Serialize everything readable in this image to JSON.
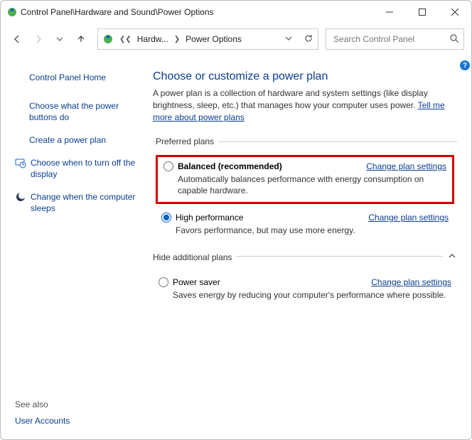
{
  "window": {
    "title": "Control Panel\\Hardware and Sound\\Power Options"
  },
  "nav": {
    "crumb1": "Hardw...",
    "crumb2": "Power Options"
  },
  "search": {
    "placeholder": "Search Control Panel"
  },
  "sidebar": {
    "home": "Control Panel Home",
    "whatbuttons": "Choose what the power buttons do",
    "createplan": "Create a power plan",
    "whenoff": "Choose when to turn off the display",
    "whensleep": "Change when the computer sleeps",
    "seealso_label": "See also",
    "useraccounts": "User Accounts"
  },
  "page": {
    "title": "Choose or customize a power plan",
    "intro1": "A power plan is a collection of hardware and system settings (like display brightness, sleep, etc.) that manages how your computer uses power. ",
    "intro_link": "Tell me more about power plans",
    "preferred_label": "Preferred plans",
    "hide_label": "Hide additional plans",
    "change_settings": "Change plan settings",
    "help": "?"
  },
  "plans": {
    "balanced": {
      "name": "Balanced (recommended)",
      "desc": "Automatically balances performance with energy consumption on capable hardware."
    },
    "high": {
      "name": "High performance",
      "desc": "Favors performance, but may use more energy."
    },
    "saver": {
      "name": "Power saver",
      "desc": "Saves energy by reducing your computer's performance where possible."
    }
  }
}
